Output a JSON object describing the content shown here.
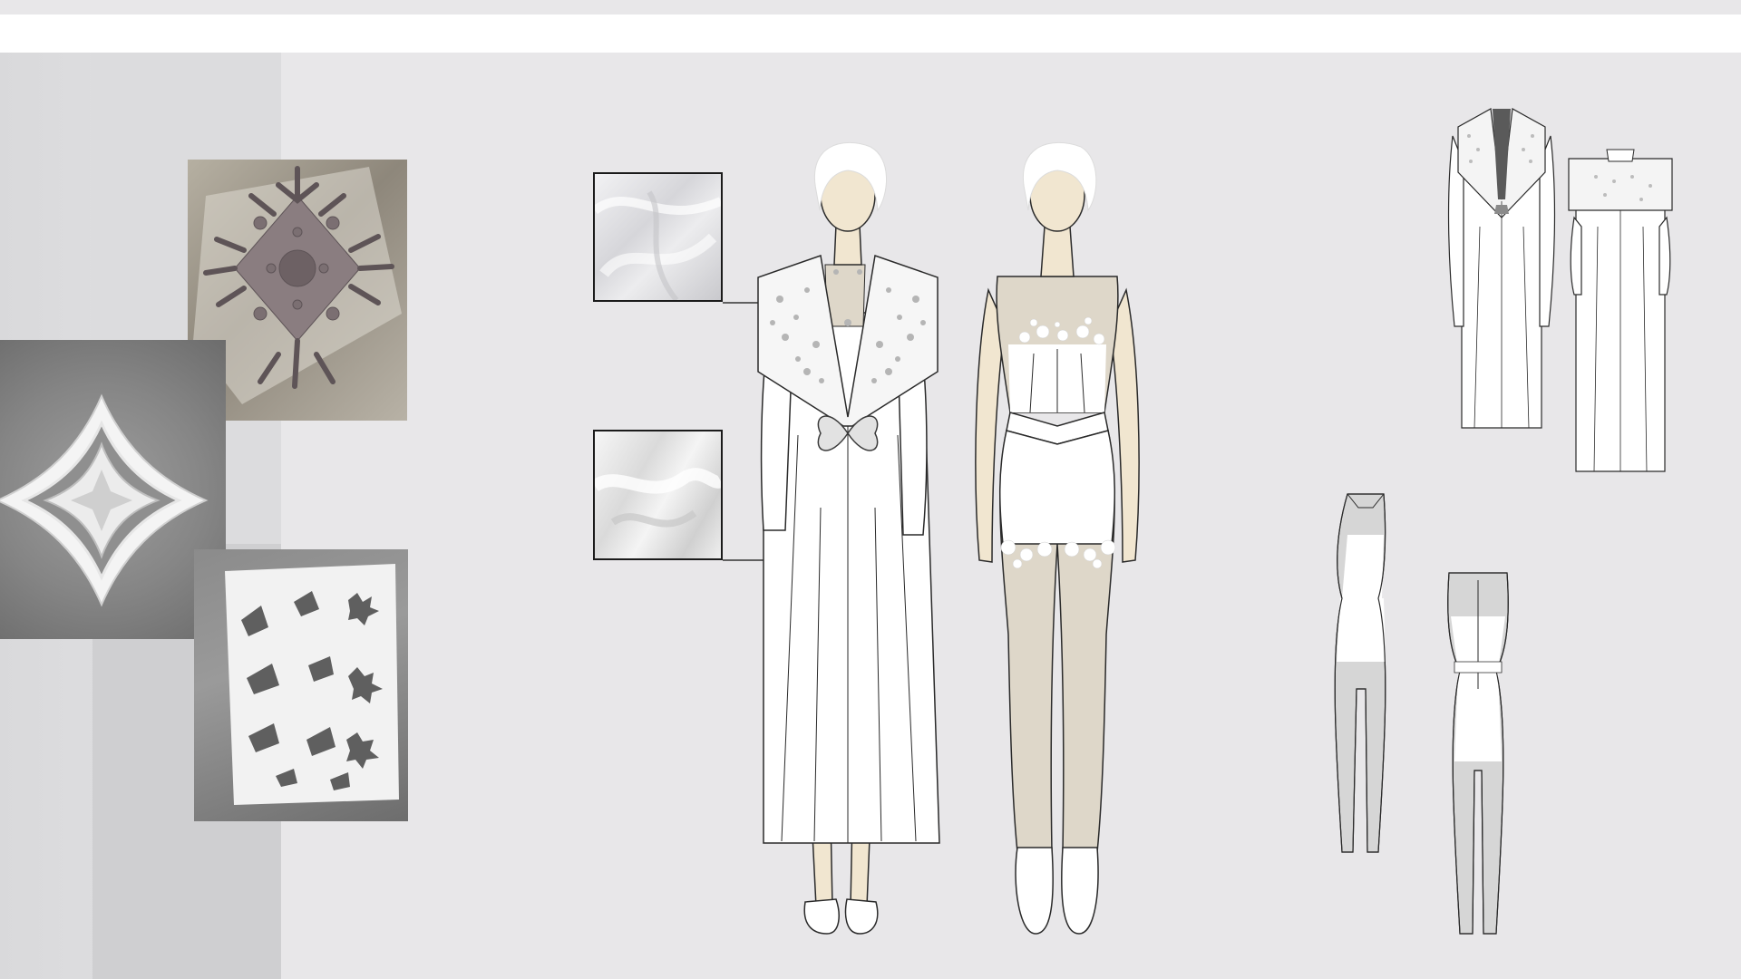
{
  "board": {
    "colors": {
      "background": "#e8e7e9",
      "header_bar": "#ffffff",
      "skin": "#f1e6d0",
      "hair": "#ffffff",
      "lace_gray": "#b5b5b5",
      "sheer_beige": "#ded7c9",
      "outline": "#2a2a2a"
    },
    "inspiration_photos": [
      {
        "name": "paper-cut-lace-square",
        "icon": "lace-cutout-icon"
      },
      {
        "name": "paper-cut-four-petal-flower",
        "icon": "flower-cutout-icon"
      },
      {
        "name": "paper-cut-leaf-pattern",
        "icon": "leaf-cutout-icon"
      }
    ],
    "fabric_swatches": [
      {
        "name": "sheer-chiffon",
        "icon": "fabric-swatch-icon"
      },
      {
        "name": "matte-crepe",
        "icon": "fabric-swatch-icon"
      }
    ],
    "illustrations": [
      {
        "name": "coat-look",
        "icon": "fashion-figure-icon"
      },
      {
        "name": "jumpsuit-look",
        "icon": "fashion-figure-icon"
      }
    ],
    "flats": [
      {
        "name": "coat-front-flat",
        "icon": "garment-flat-icon"
      },
      {
        "name": "coat-back-flat",
        "icon": "garment-flat-icon"
      },
      {
        "name": "jumpsuit-front-flat",
        "icon": "garment-flat-icon"
      },
      {
        "name": "jumpsuit-back-flat",
        "icon": "garment-flat-icon"
      }
    ]
  }
}
